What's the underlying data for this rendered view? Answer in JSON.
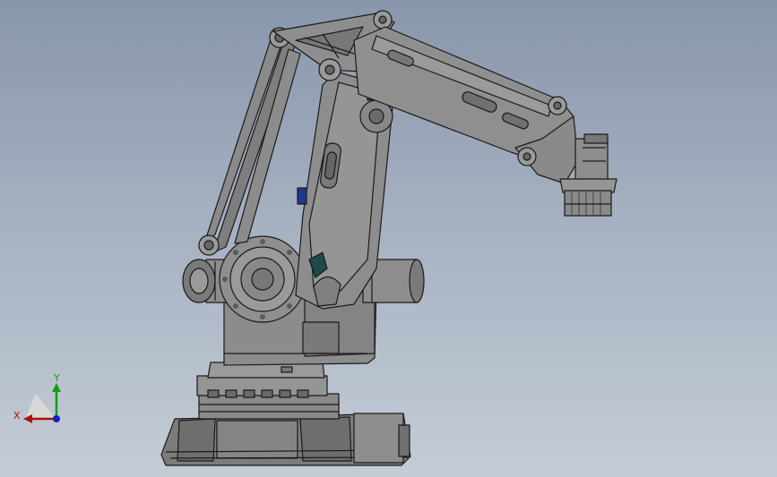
{
  "triad": {
    "x_label": "X",
    "y_label": "Y",
    "x_color": "#b01010",
    "y_color": "#10a010",
    "origin_color": "#1020c0"
  },
  "scene": {
    "background_top": "#8896ab",
    "background_bottom": "#c4ccd6",
    "body_color": "#8a8a8a",
    "edge_color": "#1a1a1a",
    "accent_color": "#1a3a8a"
  }
}
